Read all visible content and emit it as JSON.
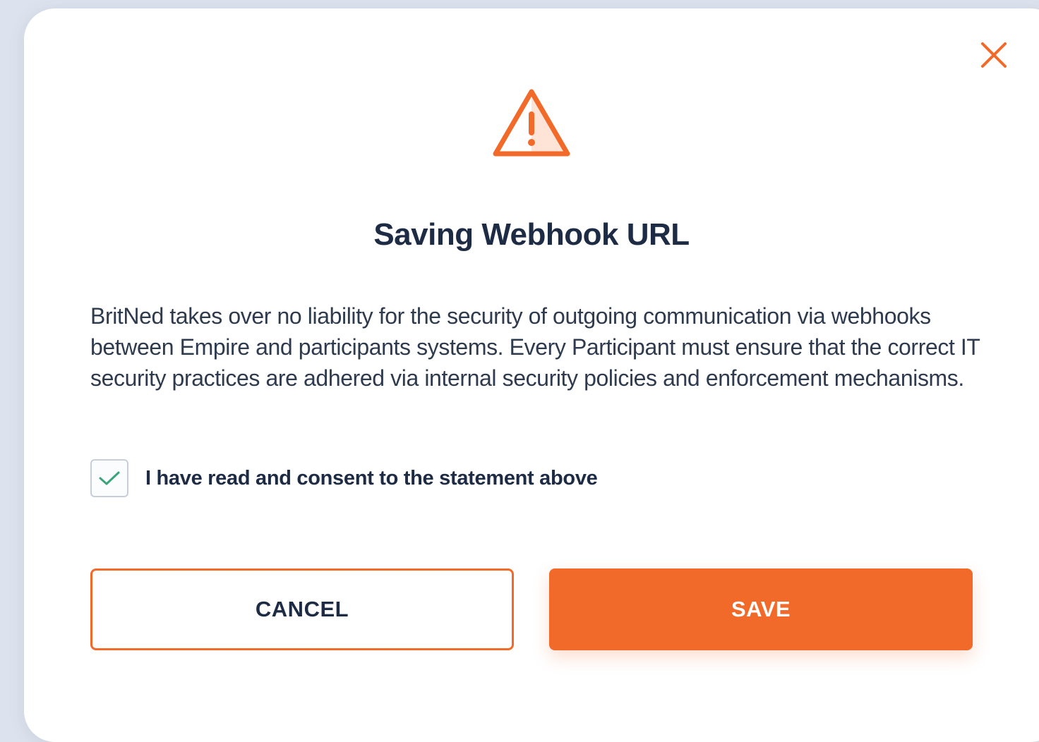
{
  "dialog": {
    "title": "Saving Webhook URL",
    "message": "BritNed takes over no liability for the security of outgoing communication via webhooks between Empire and participants systems. Every Participant must ensure that the correct IT security practices are adhered via internal security policies and enforcement mechanisms.",
    "close_icon": "close-icon",
    "warning_icon": "warning-triangle-icon",
    "consent": {
      "label": "I have read and consent to the statement above",
      "checked": true
    },
    "buttons": {
      "cancel_label": "CANCEL",
      "save_label": "SAVE"
    }
  },
  "colors": {
    "accent": "#f26a2a",
    "check": "#3aa57a",
    "title": "#1d2b45",
    "backdrop": "#dde3ee"
  }
}
